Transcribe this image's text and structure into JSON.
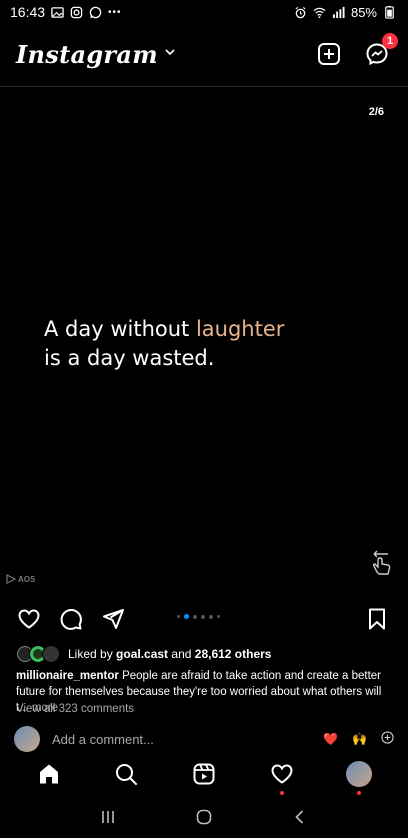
{
  "status_bar": {
    "time": "16:43",
    "more": "•••",
    "battery": "85%"
  },
  "header": {
    "logo": "Instagram",
    "notification_count": "1"
  },
  "post": {
    "slide_counter": "2/6",
    "quote_line1_prefix": "A day without ",
    "quote_line1_accent": "laughter",
    "quote_line2": "is a day wasted.",
    "watermark": "AOS",
    "accent_color": "#e8b48c"
  },
  "engagement": {
    "liked_by_prefix": "Liked by ",
    "liked_by_user": "goal.cast",
    "liked_by_middle": " and ",
    "liked_by_count": "28,612 others"
  },
  "caption": {
    "username": "millionaire_mentor",
    "text": " People are afraid to take action and create a better future for themselves because they're too worried about what others will t...",
    "more": " more"
  },
  "comments": {
    "view_all": "View all 323 comments",
    "placeholder": "Add a comment...",
    "react_heart": "❤️",
    "react_hands": "🙌"
  },
  "icons": {
    "home": "home-icon",
    "search": "search-icon",
    "reels": "reels-icon",
    "activity": "heart-icon",
    "profile": "profile-avatar"
  }
}
